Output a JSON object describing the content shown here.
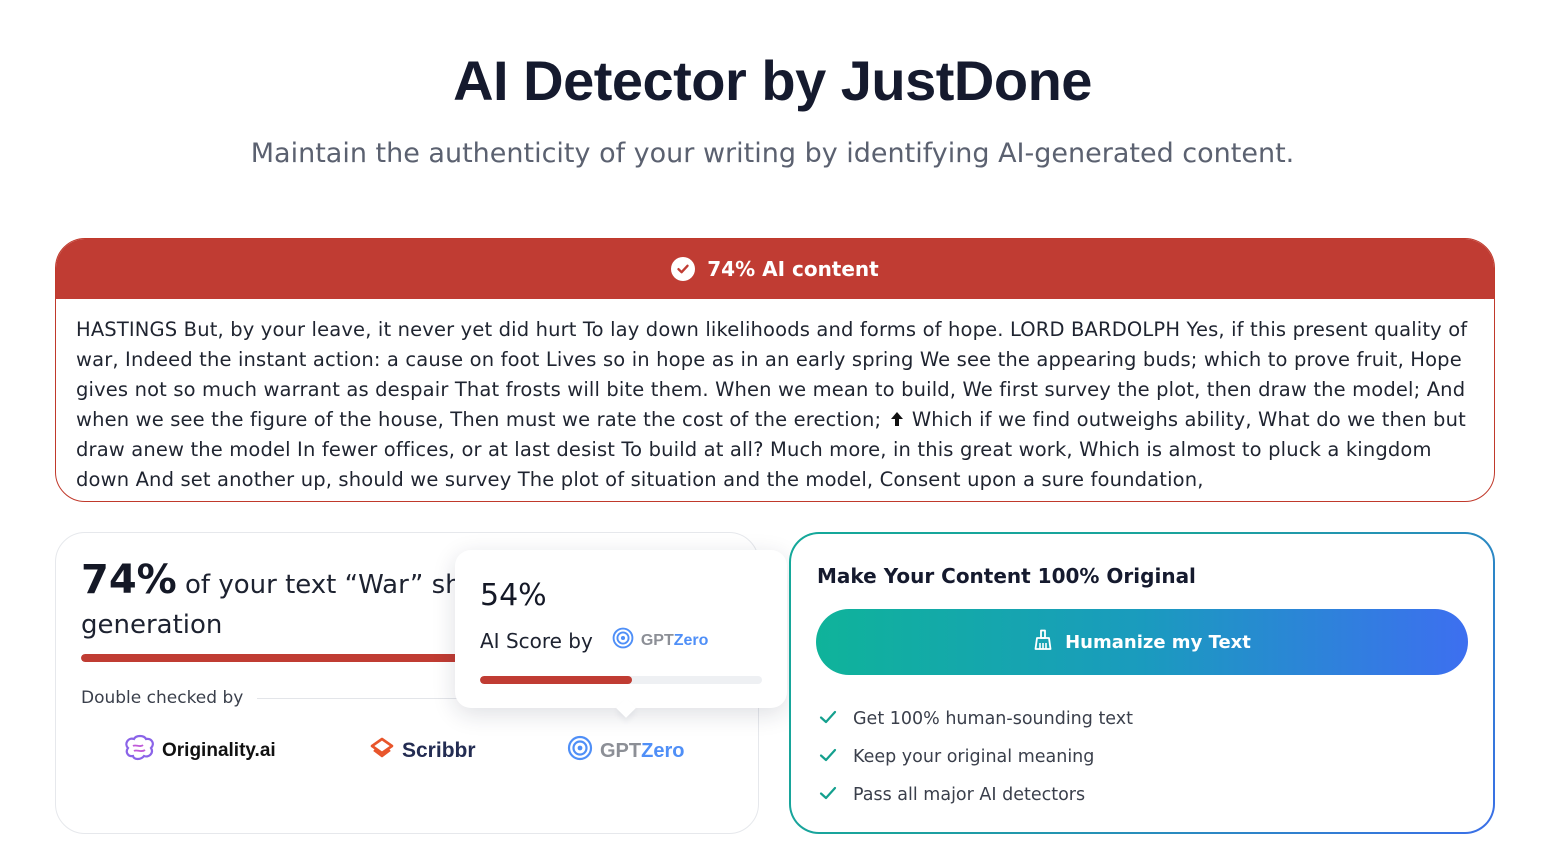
{
  "header": {
    "title": "AI Detector by JustDone",
    "subtitle": "Maintain the authenticity of your writing by identifying AI-generated content."
  },
  "result": {
    "banner_label": "74% AI content",
    "text_before_icon": "HASTINGS But, by your leave, it never yet did hurt To lay down likelihoods and forms of hope. LORD BARDOLPH Yes, if this present quality of war, Indeed the instant action: a cause on foot Lives so in hope as in an early spring We see the appearing buds; which to prove fruit, Hope gives not so much warrant as despair That frosts will bite them. When we mean to build, We first survey the plot, then draw the model; And when we see the figure of the house, Then must we rate the cost of the erection; ",
    "text_after_icon": " Which if we find outweighs ability, What do we then but draw anew the model In fewer offices, or at last desist To build at all? Much more, in this great work, Which is almost to pluck a kingdom down And set another up, should we survey The plot of situation and the model, Consent upon a sure foundation,",
    "accent_color": "#c03c33"
  },
  "score": {
    "percent_label": "74%",
    "text_visible": " of your text “War” sh",
    "text_line2": "generation",
    "ai_fraction": 0.74,
    "double_checked_label": "Double checked by",
    "logos": [
      {
        "name": "Originality.ai",
        "icon": "brain-icon"
      },
      {
        "name": "Scribbr",
        "icon": "scribbr-icon"
      },
      {
        "name_a": "GPT",
        "name_b": "Zero",
        "icon": "gptzero-icon"
      }
    ]
  },
  "popup": {
    "percent_label": "54%",
    "by_label": "AI Score by",
    "logo_a": "GPT",
    "logo_b": "Zero",
    "fraction": 0.54
  },
  "cta": {
    "title": "Make Your Content 100% Original",
    "button_label": "Humanize my Text",
    "benefits": [
      "Get 100% human-sounding text",
      "Keep your original meaning",
      "Pass all major AI detectors"
    ],
    "check_color": "#14a08e"
  }
}
